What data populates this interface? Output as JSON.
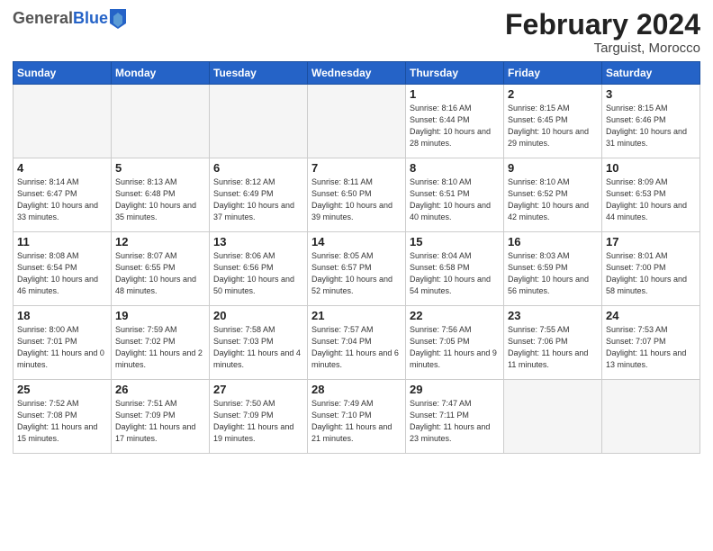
{
  "header": {
    "logo_general": "General",
    "logo_blue": "Blue",
    "month_title": "February 2024",
    "location": "Targuist, Morocco"
  },
  "days_of_week": [
    "Sunday",
    "Monday",
    "Tuesday",
    "Wednesday",
    "Thursday",
    "Friday",
    "Saturday"
  ],
  "weeks": [
    [
      {
        "day": "",
        "empty": true
      },
      {
        "day": "",
        "empty": true
      },
      {
        "day": "",
        "empty": true
      },
      {
        "day": "",
        "empty": true
      },
      {
        "day": "1",
        "sunrise": "Sunrise: 8:16 AM",
        "sunset": "Sunset: 6:44 PM",
        "daylight": "Daylight: 10 hours and 28 minutes."
      },
      {
        "day": "2",
        "sunrise": "Sunrise: 8:15 AM",
        "sunset": "Sunset: 6:45 PM",
        "daylight": "Daylight: 10 hours and 29 minutes."
      },
      {
        "day": "3",
        "sunrise": "Sunrise: 8:15 AM",
        "sunset": "Sunset: 6:46 PM",
        "daylight": "Daylight: 10 hours and 31 minutes."
      }
    ],
    [
      {
        "day": "4",
        "sunrise": "Sunrise: 8:14 AM",
        "sunset": "Sunset: 6:47 PM",
        "daylight": "Daylight: 10 hours and 33 minutes."
      },
      {
        "day": "5",
        "sunrise": "Sunrise: 8:13 AM",
        "sunset": "Sunset: 6:48 PM",
        "daylight": "Daylight: 10 hours and 35 minutes."
      },
      {
        "day": "6",
        "sunrise": "Sunrise: 8:12 AM",
        "sunset": "Sunset: 6:49 PM",
        "daylight": "Daylight: 10 hours and 37 minutes."
      },
      {
        "day": "7",
        "sunrise": "Sunrise: 8:11 AM",
        "sunset": "Sunset: 6:50 PM",
        "daylight": "Daylight: 10 hours and 39 minutes."
      },
      {
        "day": "8",
        "sunrise": "Sunrise: 8:10 AM",
        "sunset": "Sunset: 6:51 PM",
        "daylight": "Daylight: 10 hours and 40 minutes."
      },
      {
        "day": "9",
        "sunrise": "Sunrise: 8:10 AM",
        "sunset": "Sunset: 6:52 PM",
        "daylight": "Daylight: 10 hours and 42 minutes."
      },
      {
        "day": "10",
        "sunrise": "Sunrise: 8:09 AM",
        "sunset": "Sunset: 6:53 PM",
        "daylight": "Daylight: 10 hours and 44 minutes."
      }
    ],
    [
      {
        "day": "11",
        "sunrise": "Sunrise: 8:08 AM",
        "sunset": "Sunset: 6:54 PM",
        "daylight": "Daylight: 10 hours and 46 minutes."
      },
      {
        "day": "12",
        "sunrise": "Sunrise: 8:07 AM",
        "sunset": "Sunset: 6:55 PM",
        "daylight": "Daylight: 10 hours and 48 minutes."
      },
      {
        "day": "13",
        "sunrise": "Sunrise: 8:06 AM",
        "sunset": "Sunset: 6:56 PM",
        "daylight": "Daylight: 10 hours and 50 minutes."
      },
      {
        "day": "14",
        "sunrise": "Sunrise: 8:05 AM",
        "sunset": "Sunset: 6:57 PM",
        "daylight": "Daylight: 10 hours and 52 minutes."
      },
      {
        "day": "15",
        "sunrise": "Sunrise: 8:04 AM",
        "sunset": "Sunset: 6:58 PM",
        "daylight": "Daylight: 10 hours and 54 minutes."
      },
      {
        "day": "16",
        "sunrise": "Sunrise: 8:03 AM",
        "sunset": "Sunset: 6:59 PM",
        "daylight": "Daylight: 10 hours and 56 minutes."
      },
      {
        "day": "17",
        "sunrise": "Sunrise: 8:01 AM",
        "sunset": "Sunset: 7:00 PM",
        "daylight": "Daylight: 10 hours and 58 minutes."
      }
    ],
    [
      {
        "day": "18",
        "sunrise": "Sunrise: 8:00 AM",
        "sunset": "Sunset: 7:01 PM",
        "daylight": "Daylight: 11 hours and 0 minutes."
      },
      {
        "day": "19",
        "sunrise": "Sunrise: 7:59 AM",
        "sunset": "Sunset: 7:02 PM",
        "daylight": "Daylight: 11 hours and 2 minutes."
      },
      {
        "day": "20",
        "sunrise": "Sunrise: 7:58 AM",
        "sunset": "Sunset: 7:03 PM",
        "daylight": "Daylight: 11 hours and 4 minutes."
      },
      {
        "day": "21",
        "sunrise": "Sunrise: 7:57 AM",
        "sunset": "Sunset: 7:04 PM",
        "daylight": "Daylight: 11 hours and 6 minutes."
      },
      {
        "day": "22",
        "sunrise": "Sunrise: 7:56 AM",
        "sunset": "Sunset: 7:05 PM",
        "daylight": "Daylight: 11 hours and 9 minutes."
      },
      {
        "day": "23",
        "sunrise": "Sunrise: 7:55 AM",
        "sunset": "Sunset: 7:06 PM",
        "daylight": "Daylight: 11 hours and 11 minutes."
      },
      {
        "day": "24",
        "sunrise": "Sunrise: 7:53 AM",
        "sunset": "Sunset: 7:07 PM",
        "daylight": "Daylight: 11 hours and 13 minutes."
      }
    ],
    [
      {
        "day": "25",
        "sunrise": "Sunrise: 7:52 AM",
        "sunset": "Sunset: 7:08 PM",
        "daylight": "Daylight: 11 hours and 15 minutes."
      },
      {
        "day": "26",
        "sunrise": "Sunrise: 7:51 AM",
        "sunset": "Sunset: 7:09 PM",
        "daylight": "Daylight: 11 hours and 17 minutes."
      },
      {
        "day": "27",
        "sunrise": "Sunrise: 7:50 AM",
        "sunset": "Sunset: 7:09 PM",
        "daylight": "Daylight: 11 hours and 19 minutes."
      },
      {
        "day": "28",
        "sunrise": "Sunrise: 7:49 AM",
        "sunset": "Sunset: 7:10 PM",
        "daylight": "Daylight: 11 hours and 21 minutes."
      },
      {
        "day": "29",
        "sunrise": "Sunrise: 7:47 AM",
        "sunset": "Sunset: 7:11 PM",
        "daylight": "Daylight: 11 hours and 23 minutes."
      },
      {
        "day": "",
        "empty": true
      },
      {
        "day": "",
        "empty": true
      }
    ]
  ]
}
